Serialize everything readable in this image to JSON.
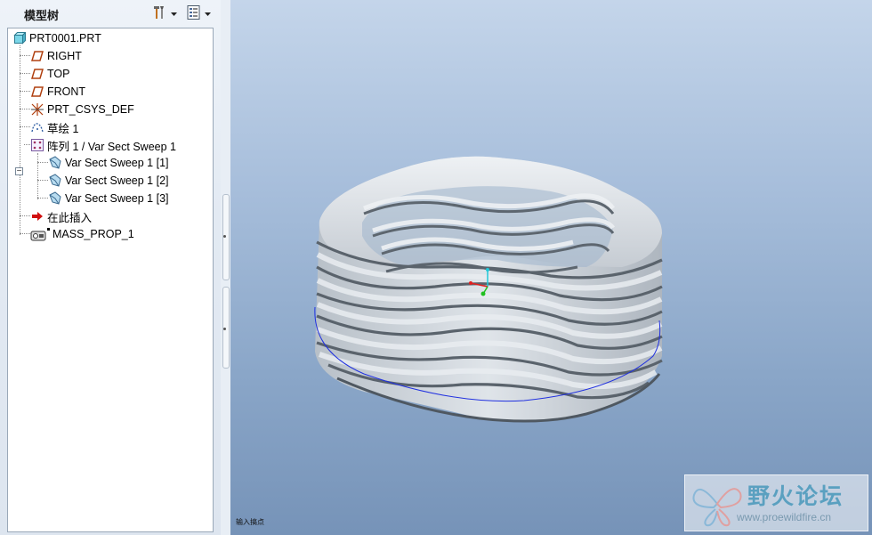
{
  "model_tree": {
    "title": "模型树",
    "tools": [
      "settings-icon",
      "show-icon"
    ],
    "items": {
      "root": "PRT0001.PRT",
      "right": "RIGHT",
      "top": "TOP",
      "front": "FRONT",
      "csys": "PRT_CSYS_DEF",
      "sketch": "草绘 1",
      "pattern": "阵列 1 / Var Sect Sweep 1",
      "sweep1": "Var Sect Sweep 1 [1]",
      "sweep2": "Var Sect Sweep 1 [2]",
      "sweep3": "Var Sect Sweep 1 [3]",
      "insert": "在此插入",
      "mass": "MASS_PROP_1"
    }
  },
  "viewport": {
    "status_text": "输入搞点",
    "background_colors": [
      "#c4d5ea",
      "#7693b8"
    ],
    "model": "wave-spring"
  },
  "watermark": {
    "title": "野火论坛",
    "url": "www.proewildfire.cn"
  }
}
